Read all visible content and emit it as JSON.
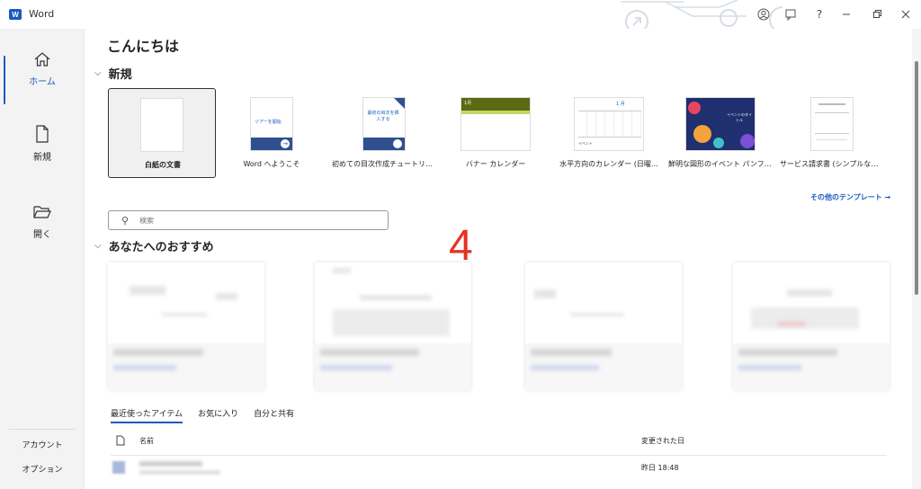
{
  "titlebar": {
    "app_name": "Word",
    "help": "?",
    "icon_letter": "W"
  },
  "nav": {
    "home": "ホーム",
    "new": "新規",
    "open": "開く",
    "account": "アカウント",
    "options": "オプション"
  },
  "main": {
    "greeting": "こんにちは",
    "new_section": "新規",
    "templates": [
      {
        "label": "白紙の文書"
      },
      {
        "label": "Word へようこそ",
        "thumb_text": "ツアーを開始"
      },
      {
        "label": "初めての目次作成チュートリアル",
        "thumb_text": "最初の目次を挿入する"
      },
      {
        "label": "バナー カレンダー",
        "thumb_text": "1月"
      },
      {
        "label": "水平方向のカレンダー (日曜…",
        "thumb_text": "1 月",
        "thumb_sub": "イベント"
      },
      {
        "label": "鮮明な図形のイベント パンフレ…",
        "thumb_text": "イベントのタイトル"
      },
      {
        "label": "サービス請求書 (シンプルな線…"
      }
    ],
    "more_templates": "その他のテンプレート →",
    "search_placeholder": "検索",
    "recommended_section": "あなたへのおすすめ",
    "annotation_number": "4",
    "tabs": [
      "最近使ったアイテム",
      "お気に入り",
      "自分と共有"
    ],
    "file_list": {
      "col_name": "名前",
      "col_modified": "変更された日",
      "rows": [
        {
          "modified": "昨日 18:48"
        }
      ]
    }
  },
  "colors": {
    "accent": "#185abd",
    "annotation": "#e53323"
  }
}
